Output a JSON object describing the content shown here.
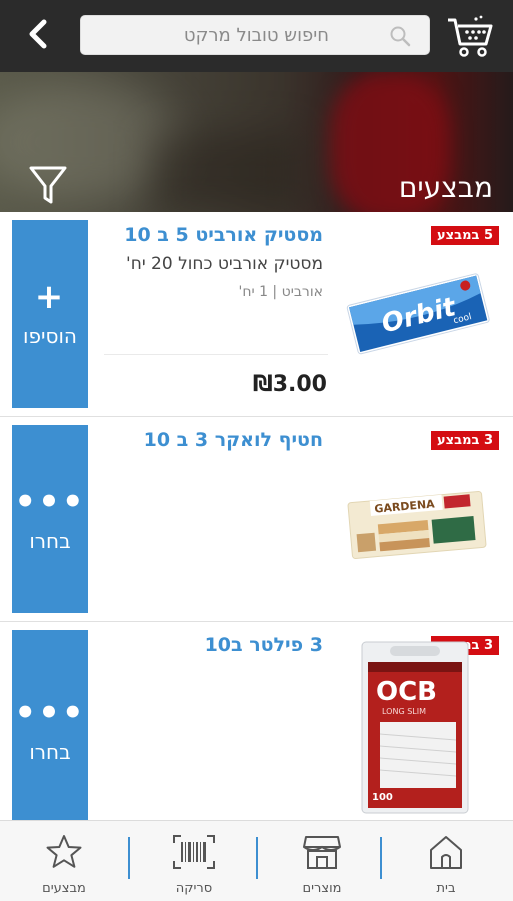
{
  "header": {
    "search_placeholder": "חיפוש טובול מרקט",
    "back_icon": "chevron-left-icon",
    "cart_icon": "shopping-cart-icon"
  },
  "banner": {
    "title": "מבצעים",
    "filter_icon": "filter-icon"
  },
  "products": [
    {
      "badge": "5 במבצע",
      "title": "מסטיק אורביט 5 ב 10",
      "description": "מסטיק אורביט כחול 20 יח'",
      "brand": "אורביט",
      "unit": "1 יח'",
      "price": "₪3.00",
      "action_symbol": "+",
      "action_label": "הוסיפו",
      "image": "orbit-gum-image"
    },
    {
      "badge": "3 במבצע",
      "title": "חטיף לואקר 3 ב 10",
      "action_symbol": "•••",
      "action_label": "בחרו",
      "image": "gardena-wafer-image"
    },
    {
      "badge": "3 במבצע",
      "title": "3 פילטר ב10",
      "action_symbol": "•••",
      "action_label": "בחרו",
      "image": "ocb-filters-image"
    }
  ],
  "bottom_nav": [
    {
      "label": "מבצעים",
      "icon": "star-icon"
    },
    {
      "label": "סריקה",
      "icon": "barcode-icon"
    },
    {
      "label": "מוצרים",
      "icon": "store-icon"
    },
    {
      "label": "בית",
      "icon": "home-icon"
    }
  ],
  "colors": {
    "accent": "#3d8fd1",
    "badge": "#d40d12",
    "header": "#2b2b2b"
  }
}
